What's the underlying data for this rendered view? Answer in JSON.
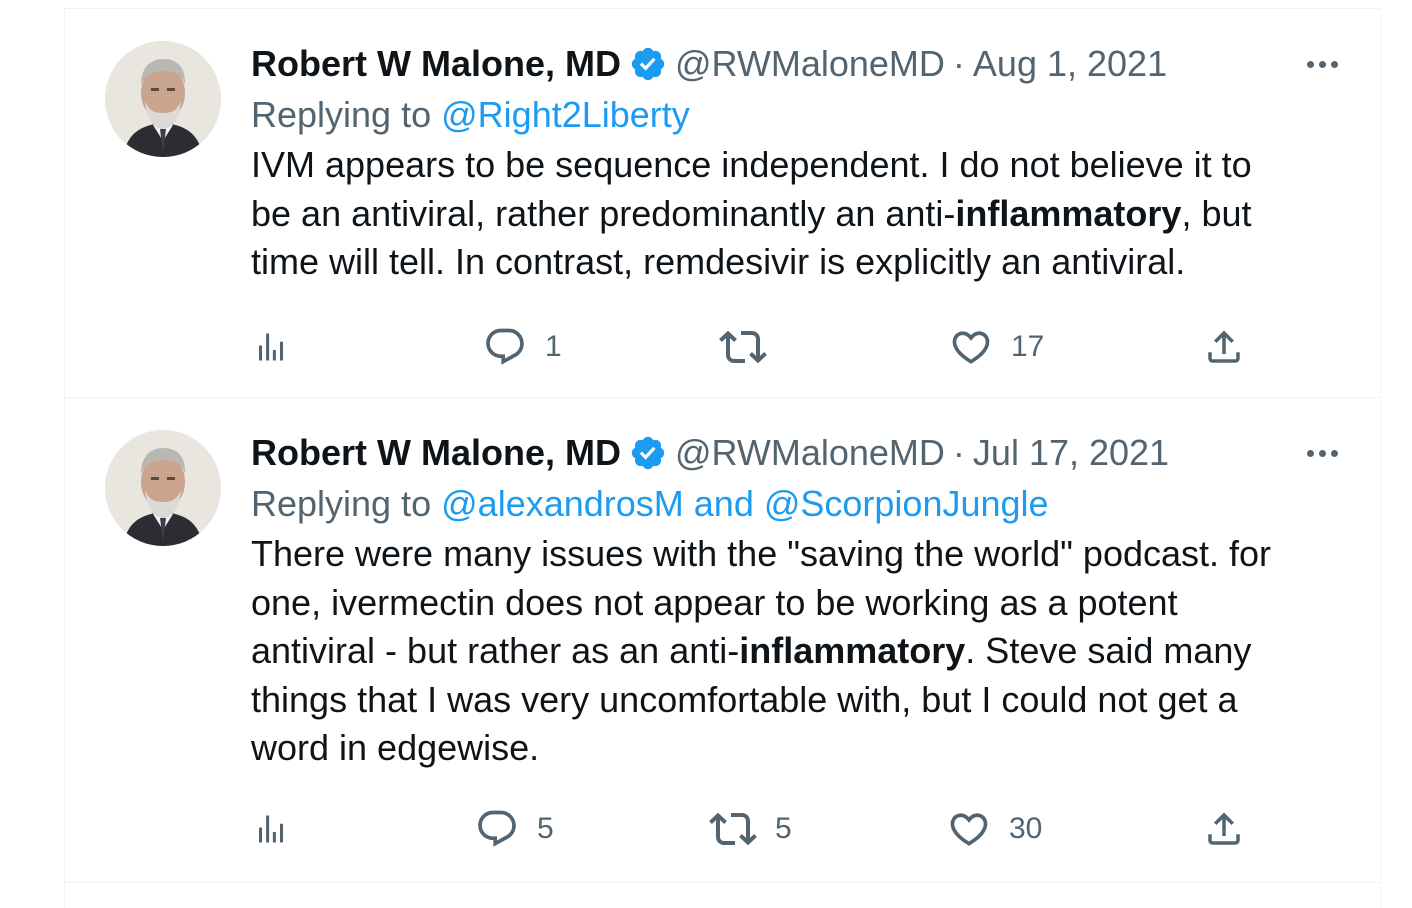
{
  "tweets": [
    {
      "author_name": "Robert W Malone, MD",
      "handle": "@RWMaloneMD",
      "separator": "·",
      "date": "Aug 1, 2021",
      "replying_prefix": "Replying to",
      "reply_mentions": "@Right2Liberty",
      "body_lines": [
        [
          "IVM appears to be sequence independent.  I do not believe it to",
          "",
          ""
        ],
        [
          "be an antiviral, rather predominantly an anti-",
          "inflammatory",
          ", but"
        ],
        [
          "time will tell.  In contrast, remdesivir is explicitly an antiviral.",
          "",
          ""
        ]
      ],
      "actions": {
        "views_icon": "analytics-icon",
        "reply_icon": "reply-icon",
        "reply_count": "1",
        "retweet_icon": "retweet-icon",
        "retweet_count": "",
        "like_icon": "heart-icon",
        "like_count": "17",
        "share_icon": "share-icon"
      }
    },
    {
      "author_name": "Robert W Malone, MD",
      "handle": "@RWMaloneMD",
      "separator": "·",
      "date": "Jul 17, 2021",
      "replying_prefix": "Replying to",
      "reply_mentions": "@alexandrosM and @ScorpionJungle",
      "body_lines": [
        [
          "There were many issues with the \"saving the world\" podcast.  for",
          "",
          ""
        ],
        [
          "one, ivermectin does not appear to be working as a potent",
          "",
          ""
        ],
        [
          "antiviral - but rather as an anti-",
          "inflammatory",
          ".  Steve said many"
        ],
        [
          "things that I was very uncomfortable with, but I could not get a",
          "",
          ""
        ],
        [
          "word in edgewise.",
          "",
          ""
        ]
      ],
      "actions": {
        "views_icon": "analytics-icon",
        "reply_icon": "reply-icon",
        "reply_count": "5",
        "retweet_icon": "retweet-icon",
        "retweet_count": "5",
        "like_icon": "heart-icon",
        "like_count": "30",
        "share_icon": "share-icon"
      }
    }
  ],
  "colors": {
    "text_primary": "#0f1419",
    "text_secondary": "#536471",
    "accent_link": "#1d9bf0",
    "verified_badge": "#1d9bf0",
    "divider": "#eff3f4"
  }
}
